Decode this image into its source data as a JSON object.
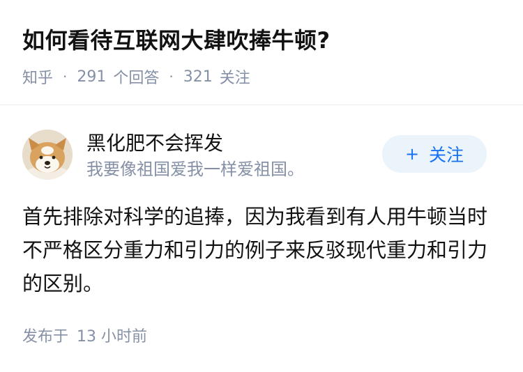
{
  "question": {
    "title": "如何看待互联网大肆吹捧牛顿?",
    "source": "知乎",
    "answer_count": "291",
    "answer_label": "个回答",
    "follower_count": "321",
    "follower_label": "关注",
    "separator": "·"
  },
  "author": {
    "name": "黑化肥不会挥发",
    "bio": "我要像祖国爱我一样爱祖国。",
    "avatar_icon": "shiba-dog-avatar",
    "follow_plus": "+",
    "follow_label": "关注",
    "follow_color": "#1772f6"
  },
  "answer": {
    "text": "首先排除对科学的追捧，因为我看到有人用牛顿当时不严格区分重力和引力的例子来反驳现代重力和引力的区别。"
  },
  "footer": {
    "published_label": "发布于",
    "published_time": "13 小时前"
  }
}
